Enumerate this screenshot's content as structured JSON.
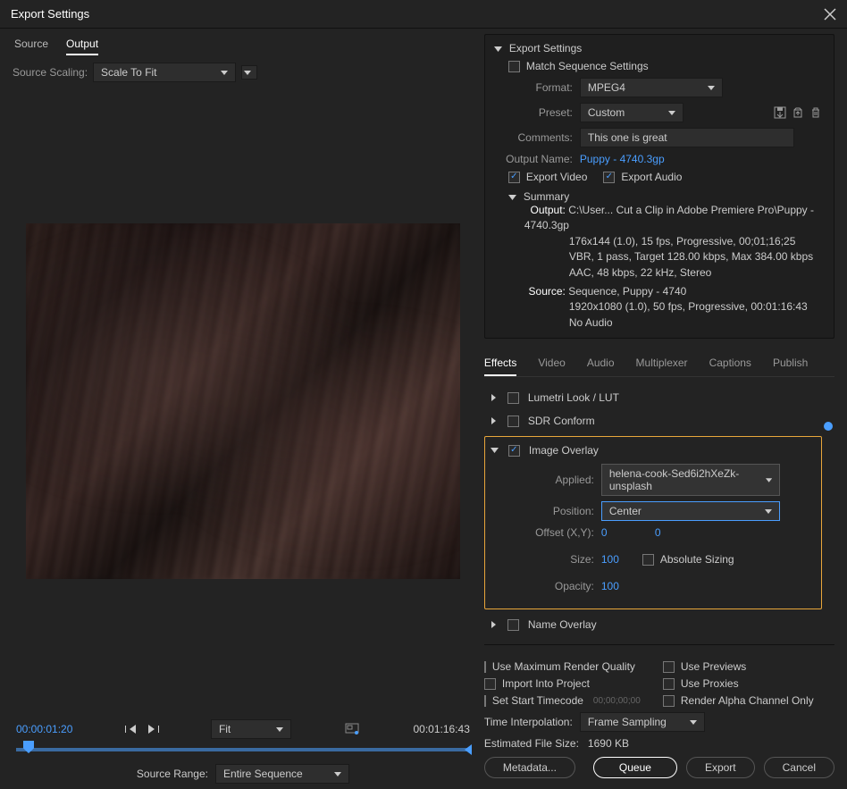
{
  "window": {
    "title": "Export Settings"
  },
  "leftPanel": {
    "tabs": {
      "source": "Source",
      "output": "Output",
      "active": "output"
    },
    "sourceScalingLabel": "Source Scaling:",
    "sourceScalingValue": "Scale To Fit",
    "currentTime": "00:00:01:20",
    "fitLabel": "Fit",
    "duration": "00:01:16:43",
    "sourceRangeLabel": "Source Range:",
    "sourceRangeValue": "Entire Sequence"
  },
  "exportSettings": {
    "header": "Export Settings",
    "matchSequence": "Match Sequence Settings",
    "formatLabel": "Format:",
    "formatValue": "MPEG4",
    "presetLabel": "Preset:",
    "presetValue": "Custom",
    "commentsLabel": "Comments:",
    "commentsValue": "This one is great",
    "outputNameLabel": "Output Name:",
    "outputNameValue": "Puppy - 4740.3gp",
    "exportVideo": "Export Video",
    "exportAudio": "Export Audio",
    "summaryLabel": "Summary",
    "outputLabel": "Output:",
    "outputLine1": "C:\\User... Cut a Clip in Adobe Premiere Pro\\Puppy - 4740.3gp",
    "outputLine2": "176x144 (1.0), 15 fps, Progressive, 00;01;16;25",
    "outputLine3": "VBR, 1 pass, Target 128.00 kbps, Max 384.00 kbps",
    "outputLine4": "AAC, 48 kbps, 22 kHz, Stereo",
    "sourceLabel": "Source:",
    "sourceLine1": "Sequence, Puppy - 4740",
    "sourceLine2": "1920x1080 (1.0), 50 fps, Progressive, 00:01:16:43",
    "sourceLine3": "No Audio"
  },
  "effectTabs": {
    "effects": "Effects",
    "video": "Video",
    "audio": "Audio",
    "multiplexer": "Multiplexer",
    "captions": "Captions",
    "publish": "Publish",
    "active": "effects"
  },
  "effects": {
    "lumetri": "Lumetri Look / LUT",
    "sdr": "SDR Conform",
    "imageOverlay": {
      "title": "Image Overlay",
      "appliedLabel": "Applied:",
      "appliedValue": "helena-cook-Sed6i2hXeZk-unsplash",
      "positionLabel": "Position:",
      "positionValue": "Center",
      "offsetLabel": "Offset (X,Y):",
      "offsetX": "0",
      "offsetY": "0",
      "sizeLabel": "Size:",
      "sizeValue": "100",
      "absSizing": "Absolute Sizing",
      "opacityLabel": "Opacity:",
      "opacityValue": "100"
    },
    "nameOverlay": "Name Overlay"
  },
  "renderOpts": {
    "maxQuality": "Use Maximum Render Quality",
    "usePreviews": "Use Previews",
    "importProject": "Import Into Project",
    "useProxies": "Use Proxies",
    "setStartTC": "Set Start Timecode",
    "startTCValue": "00;00;00;00",
    "renderAlpha": "Render Alpha Channel Only",
    "timeInterpLabel": "Time Interpolation:",
    "timeInterpValue": "Frame Sampling",
    "estLabel": "Estimated File Size:",
    "estValue": "1690 KB"
  },
  "buttons": {
    "metadata": "Metadata...",
    "queue": "Queue",
    "export": "Export",
    "cancel": "Cancel"
  }
}
